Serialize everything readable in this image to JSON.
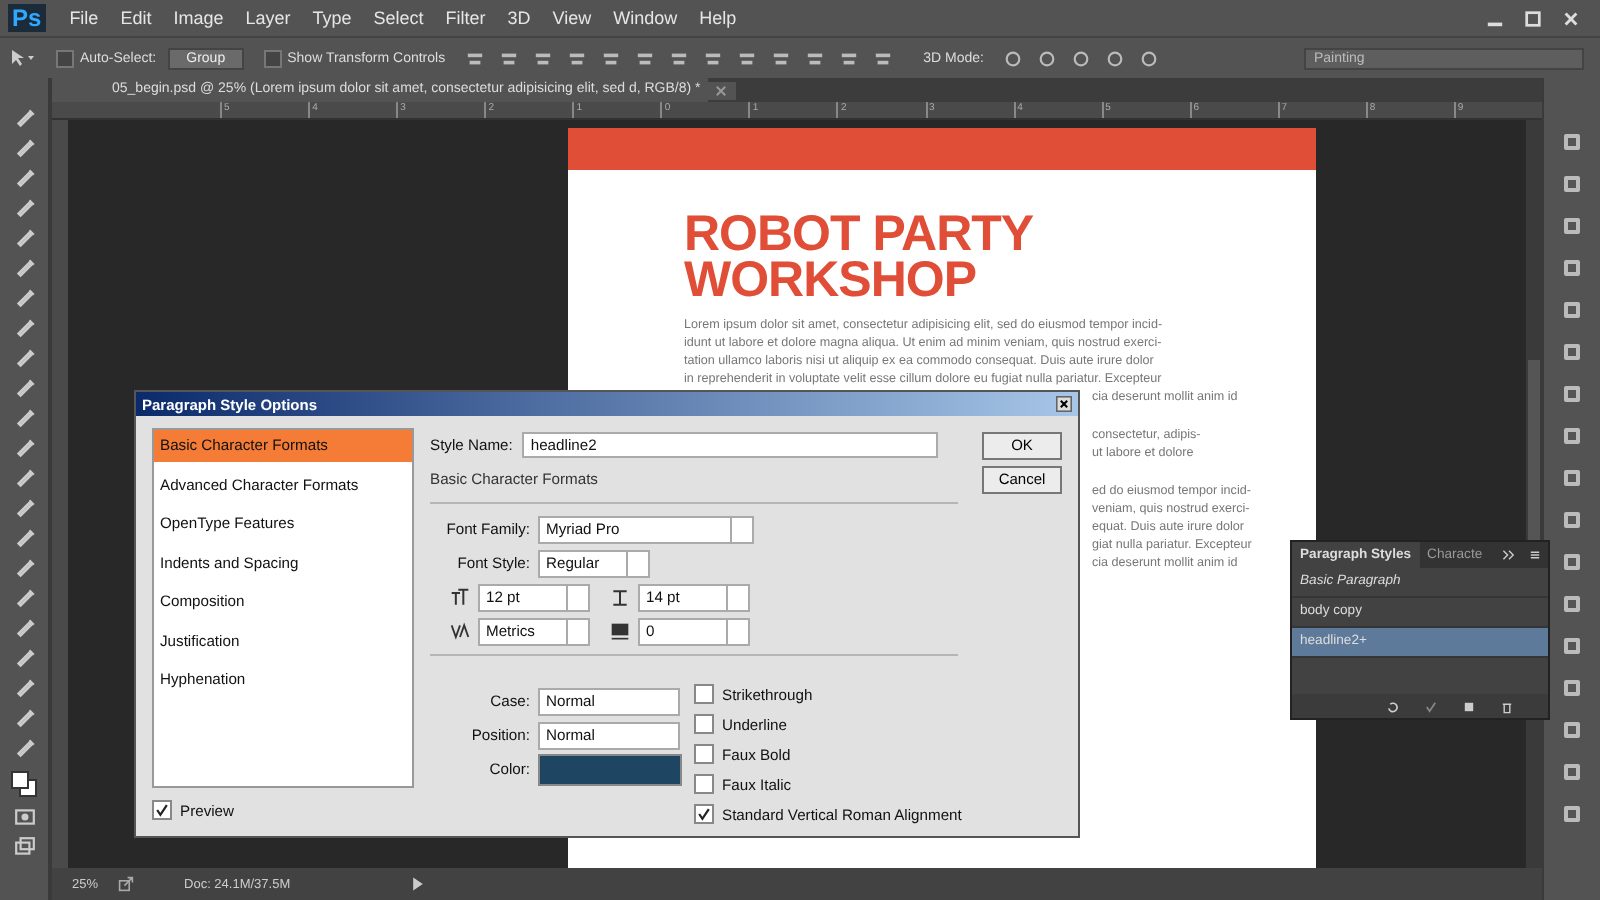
{
  "menu_bar": {
    "logo": "Ps",
    "items": [
      "File",
      "Edit",
      "Image",
      "Layer",
      "Type",
      "Select",
      "Filter",
      "3D",
      "View",
      "Window",
      "Help"
    ]
  },
  "options_bar": {
    "auto_select": {
      "label": "Auto-Select:",
      "checked": false
    },
    "auto_select_target": "Group",
    "transform_controls": {
      "label": "Show Transform Controls",
      "checked": false
    },
    "mode_label": "3D Mode:",
    "workspace": "Painting"
  },
  "document_tab": {
    "title": "05_begin.psd @ 25% (Lorem ipsum dolor sit amet, consectetur adipisicing elit, sed d, RGB/8) *"
  },
  "ruler_marks": [
    "5",
    "4",
    "3",
    "2",
    "1",
    "0",
    "1",
    "2",
    "3",
    "4",
    "5",
    "6",
    "7",
    "8",
    "9"
  ],
  "document": {
    "title_lines": [
      "ROBOT PARTY",
      "WORKSHOP"
    ],
    "paragraphs": [
      [
        {
          "kind": "full",
          "text": "Lorem ipsum dolor sit amet, consectetur adipisicing elit, sed do eiusmod tempor incid-"
        },
        {
          "kind": "full",
          "text": "idunt ut labore et dolore magna aliqua. Ut enim ad minim veniam, quis nostrud exerci-"
        },
        {
          "kind": "full",
          "text": "tation ullamco laboris nisi ut aliquip ex ea commodo consequat. Duis aute irure dolor"
        },
        {
          "kind": "full",
          "text": "in reprehenderit in voluptate velit esse cillum dolore eu fugiat nulla pariatur. Excepteur"
        },
        {
          "kind": "tail",
          "text": "cia deserunt mollit anim id"
        }
      ],
      [
        {
          "kind": "tail",
          "text": "consectetur, adipis-"
        },
        {
          "kind": "tail",
          "text": "ut labore et dolore"
        }
      ],
      [
        {
          "kind": "tail",
          "text": "ed do eiusmod tempor incid-"
        },
        {
          "kind": "tail",
          "text": "veniam, quis nostrud exerci-"
        },
        {
          "kind": "tail",
          "text": "equat. Duis aute irure dolor"
        },
        {
          "kind": "tail",
          "text": "giat nulla pariatur. Excepteur"
        },
        {
          "kind": "tail",
          "text": "cia deserunt mollit anim id"
        }
      ]
    ]
  },
  "dialog": {
    "title": "Paragraph Style Options",
    "categories": [
      {
        "label": "Basic Character Formats",
        "selected": true
      },
      {
        "label": "Advanced Character Formats",
        "selected": false
      },
      {
        "label": "OpenType Features",
        "selected": false
      },
      {
        "label": "Indents and Spacing",
        "selected": false
      },
      {
        "label": "Composition",
        "selected": false
      },
      {
        "label": "Justification",
        "selected": false
      },
      {
        "label": "Hyphenation",
        "selected": false
      }
    ],
    "style_name_label": "Style Name:",
    "style_name": "headline2",
    "section": "Basic Character Formats",
    "ok": "OK",
    "cancel": "Cancel",
    "font_family_label": "Font Family:",
    "font_family": "Myriad Pro",
    "font_style_label": "Font Style:",
    "font_style": "Regular",
    "size": "12 pt",
    "leading": "14 pt",
    "kerning": "Metrics",
    "tracking": "0",
    "case_label": "Case:",
    "case": "Normal",
    "position_label": "Position:",
    "position": "Normal",
    "color_label": "Color:",
    "color": "#1e4561",
    "options": [
      {
        "label": "Strikethrough",
        "checked": false
      },
      {
        "label": "Underline",
        "checked": false
      },
      {
        "label": "Faux Bold",
        "checked": false
      },
      {
        "label": "Faux Italic",
        "checked": false
      },
      {
        "label": "Standard Vertical Roman Alignment",
        "checked": true
      }
    ],
    "preview": {
      "label": "Preview",
      "checked": true
    }
  },
  "styles_panel": {
    "tabs": [
      {
        "label": "Paragraph Styles",
        "selected": true
      },
      {
        "label": "Characte",
        "selected": false
      }
    ],
    "items": [
      {
        "label": "Basic Paragraph",
        "kind": "base",
        "selected": false
      },
      {
        "label": "body copy",
        "kind": "style",
        "selected": false
      },
      {
        "label": "headline2+",
        "kind": "style",
        "selected": true
      }
    ]
  },
  "status_bar": {
    "zoom": "25%",
    "doc": "Doc: 24.1M/37.5M"
  }
}
